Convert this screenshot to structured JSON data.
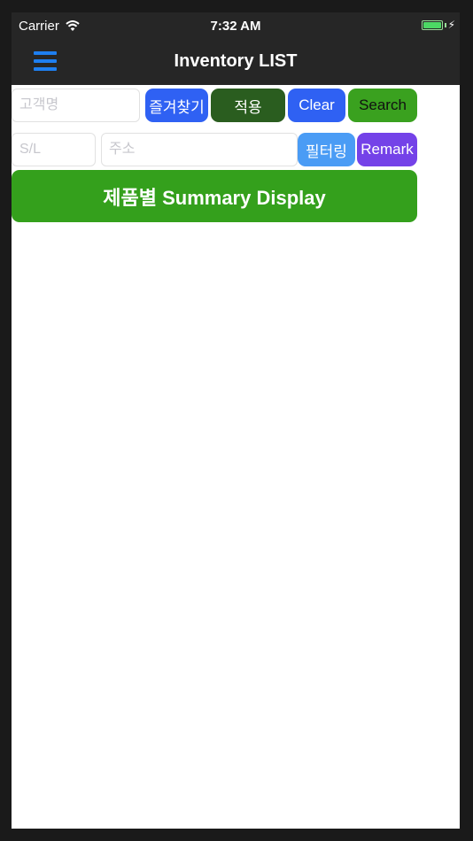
{
  "status_bar": {
    "carrier": "Carrier",
    "time": "7:32 AM"
  },
  "nav": {
    "title": "Inventory LIST",
    "menu_icon": "hamburger-menu-icon"
  },
  "row1": {
    "customer_placeholder": "고객명",
    "favorites_label": "즐겨찾기",
    "apply_label": "적용",
    "clear_label": "Clear",
    "search_label": "Search"
  },
  "row2": {
    "sl_placeholder": "S/L",
    "address_placeholder": "주소",
    "filter_label": "필터링",
    "remark_label": "Remark"
  },
  "summary_label": "제품별 Summary Display",
  "colors": {
    "nav_bg": "#262626",
    "menu_icon": "#1e7ff0",
    "favorites": "#2f61f3",
    "apply": "#2a5d1f",
    "clear": "#2f61f3",
    "search": "#3aa11f",
    "filter": "#4a9cf5",
    "remark": "#7442e8",
    "summary": "#34a01c"
  }
}
